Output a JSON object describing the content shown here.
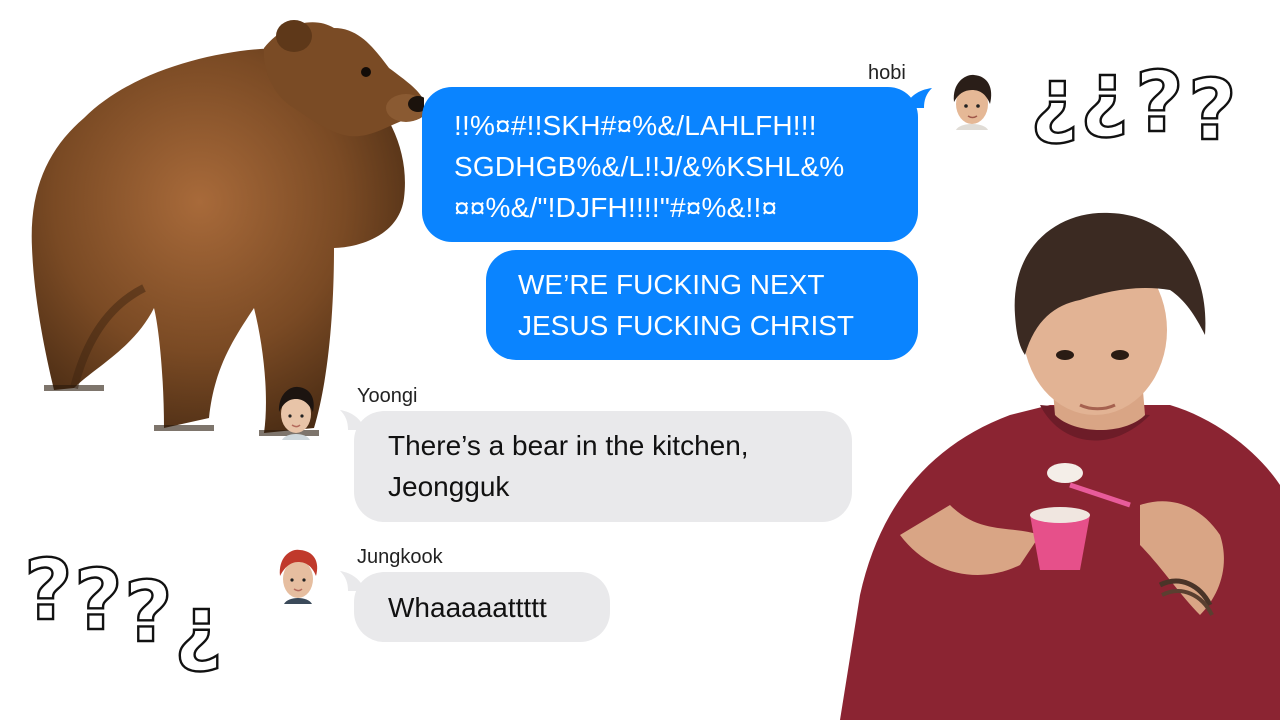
{
  "conversation": {
    "messages": [
      {
        "sender": "hobi",
        "lines": [
          "!!%¤#!!SKH#¤%&/LAHLFH!!!",
          "SGDHGB%&/L!!J/&%KSHL&%",
          "¤¤%&/\"!DJFH!!!!\"#¤%&!!¤"
        ]
      },
      {
        "sender": "hobi",
        "lines": [
          "WE’RE FUCKING NEXT",
          "JESUS FUCKING CHRIST"
        ]
      },
      {
        "sender": "Yoongi",
        "lines": [
          "There’s a bear in the kitchen,",
          "Jeongguk"
        ]
      },
      {
        "sender": "Jungkook",
        "lines": [
          "Whaaaaattttt"
        ]
      }
    ]
  },
  "decorations": {
    "question_marks_top": [
      "¿",
      "¿",
      "?",
      "?"
    ],
    "question_marks_bottom": [
      "?",
      "?",
      "?",
      "¿"
    ],
    "images": [
      "bear-illustration",
      "person-eating-photo"
    ]
  },
  "colors": {
    "outgoing_bubble": "#0a84ff",
    "incoming_bubble": "#e9e9eb",
    "background": "#ffffff"
  }
}
